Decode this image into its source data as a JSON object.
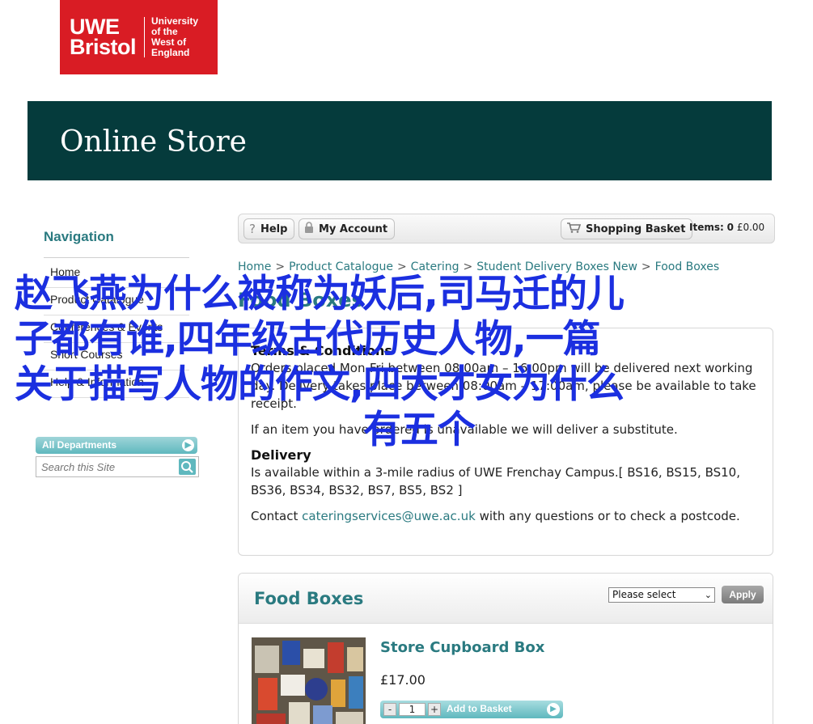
{
  "logo": {
    "main_line1": "UWE",
    "main_line2": "Bristol",
    "sub_line1": "University",
    "sub_line2": "of the",
    "sub_line3": "West of",
    "sub_line4": "England"
  },
  "banner": {
    "title": "Online Store"
  },
  "sidebar": {
    "heading": "Navigation",
    "items": [
      {
        "label": "Home"
      },
      {
        "label": "Product Catalogue"
      },
      {
        "label": "Conferences & Events"
      },
      {
        "label": "Short Courses"
      },
      {
        "label": "Help & Information"
      }
    ],
    "departments_label": "All Departments",
    "search_placeholder": "Search this Site"
  },
  "toolbar": {
    "help_label": "Help",
    "account_label": "My Account",
    "basket_label": "Shopping Basket",
    "items_label": "Items:",
    "items_count": "0",
    "total": "£0.00"
  },
  "breadcrumb": [
    "Home",
    "Product Catalogue",
    "Catering",
    "Student Delivery Boxes New",
    "Food Boxes"
  ],
  "breadcrumb_sep": ">",
  "page_title": "Food Boxes",
  "info": {
    "terms_heading": "Terms & Conditions",
    "terms_text": "Orders placed Mon-Fri between 08:00am – 16:00pm will be delivered next working day. Delivery takes place between 08:00am – 17:00am, please be available to take receipt.",
    "substitute_text": "If an item you have ordered is unavailable we will deliver a substitute.",
    "delivery_heading": "Delivery",
    "delivery_text": "Is available within a 3-mile radius of UWE Frenchay Campus.[ BS16, BS15, BS10, BS36, BS34, BS32, BS7, BS5, BS2 ]",
    "contact_prefix": "Contact",
    "contact_email": "cateringservices@uwe.ac.uk",
    "contact_suffix": "with any questions or to check a postcode."
  },
  "panel": {
    "title": "Food Boxes",
    "select_value": "Please select",
    "apply_label": "Apply"
  },
  "product": {
    "name": "Store Cupboard Box",
    "price": "£17.00",
    "quantity": "1",
    "add_label": "Add to Basket"
  },
  "overlay": {
    "line1": "赵飞燕为什么被称为妖后,司马迁的儿",
    "line2": "子都有谁,四年级古代历史人物,一篇",
    "line3": "关于描写人物的作文,四大才女为什么",
    "line4": "有五个"
  },
  "colors": {
    "brand_red": "#d91c24",
    "banner_teal": "#053b3c",
    "accent_teal": "#2a7a80",
    "button_teal": "#5fb8be",
    "overlay_blue": "#1b2fe0"
  }
}
